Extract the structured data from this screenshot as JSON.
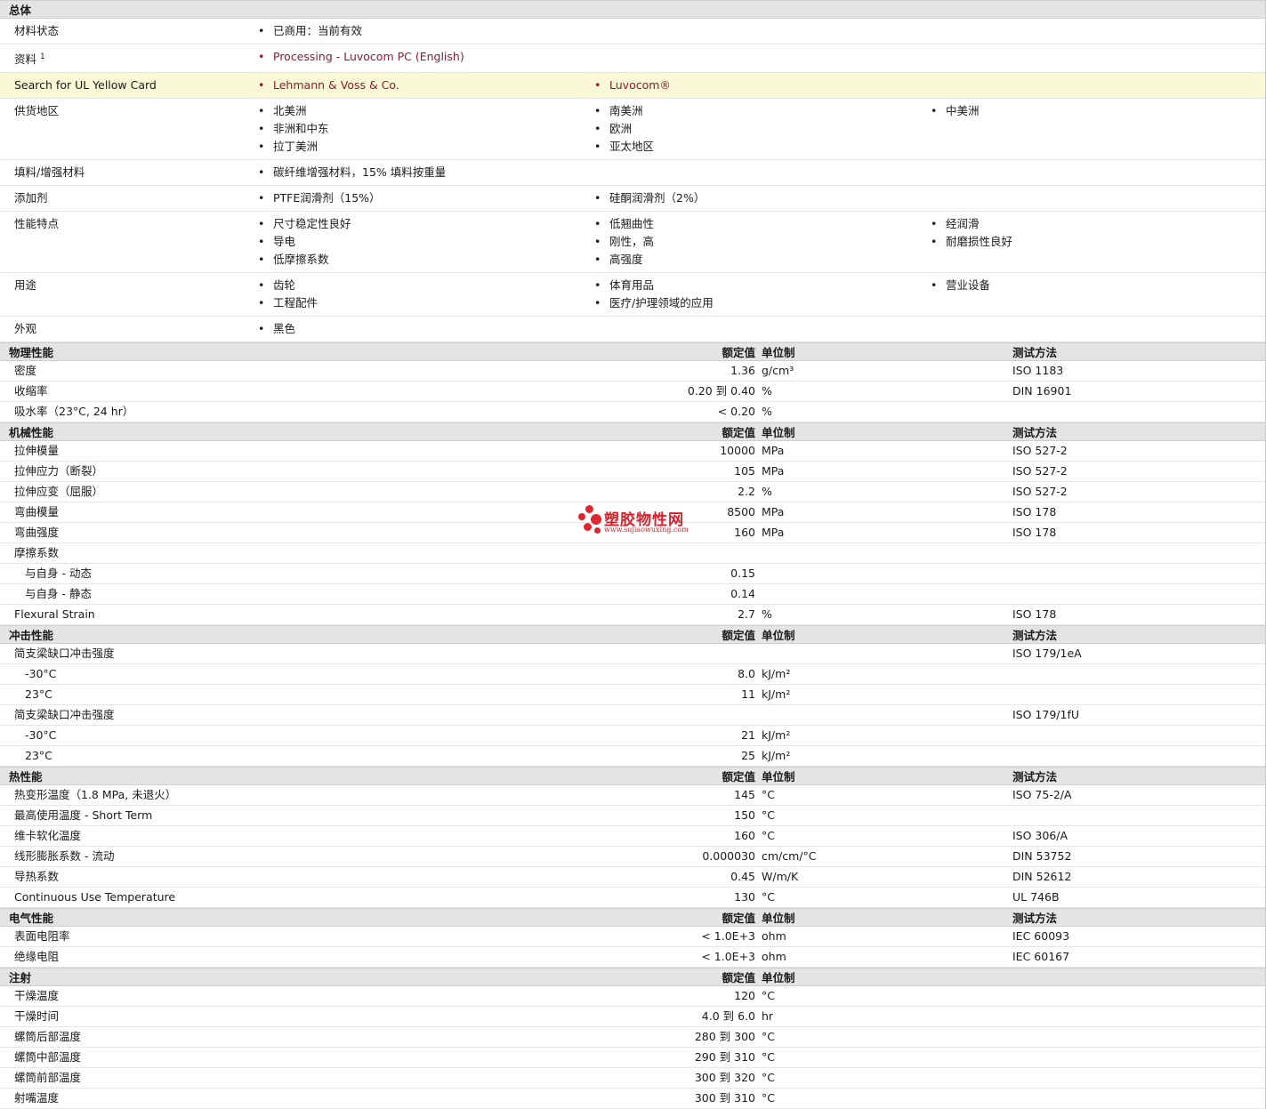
{
  "general": {
    "title": "总体",
    "rows": [
      {
        "label": "材料状态",
        "cols": [
          [
            "已商用：当前有效"
          ]
        ]
      },
      {
        "label": "资料",
        "sup": "1",
        "link": true,
        "cols": [
          [
            "Processing - Luvocom PC (English)"
          ]
        ]
      },
      {
        "label": "Search for UL Yellow Card",
        "highlight": true,
        "link": true,
        "cols": [
          [
            "Lehmann & Voss & Co."
          ],
          [
            "Luvocom®"
          ]
        ]
      },
      {
        "label": "供货地区",
        "cols": [
          [
            "北美洲",
            "非洲和中东",
            "拉丁美洲"
          ],
          [
            "南美洲",
            "欧洲",
            "亚太地区"
          ],
          [
            "中美洲"
          ]
        ]
      },
      {
        "label": "填料/增强材料",
        "cols": [
          [
            "碳纤维增强材料，15% 填料按重量"
          ]
        ]
      },
      {
        "label": "添加剂",
        "cols": [
          [
            "PTFE润滑剂（15%）"
          ],
          [
            "硅酮润滑剂（2%）"
          ]
        ]
      },
      {
        "label": "性能特点",
        "cols": [
          [
            "尺寸稳定性良好",
            "导电",
            "低摩擦系数"
          ],
          [
            "低翘曲性",
            "刚性，高",
            "高强度"
          ],
          [
            "经润滑",
            "耐磨损性良好"
          ]
        ]
      },
      {
        "label": "用途",
        "cols": [
          [
            "齿轮",
            "工程配件"
          ],
          [
            "体育用品",
            "医疗/护理领域的应用"
          ],
          [
            "营业设备"
          ]
        ]
      },
      {
        "label": "外观",
        "cols": [
          [
            "黑色"
          ]
        ]
      }
    ]
  },
  "headers": {
    "nominal": "额定值",
    "unit": "单位制",
    "test": "测试方法"
  },
  "sections": [
    {
      "title": "物理性能",
      "show_test": true,
      "rows": [
        {
          "label": "密度",
          "value": "1.36",
          "unit": "g/cm³",
          "test": "ISO 1183"
        },
        {
          "label": "收缩率",
          "value": "0.20 到  0.40",
          "unit": "%",
          "test": "DIN 16901"
        },
        {
          "label": "吸水率（23°C, 24 hr）",
          "value": "< 0.20",
          "unit": "%",
          "test": ""
        }
      ]
    },
    {
      "title": "机械性能",
      "show_test": true,
      "rows": [
        {
          "label": "拉伸模量",
          "value": "10000",
          "unit": "MPa",
          "test": "ISO 527-2"
        },
        {
          "label": "拉伸应力（断裂）",
          "value": "105",
          "unit": "MPa",
          "test": "ISO 527-2"
        },
        {
          "label": "拉伸应变（屈服）",
          "value": "2.2",
          "unit": "%",
          "test": "ISO 527-2"
        },
        {
          "label": "弯曲模量",
          "value": "8500",
          "unit": "MPa",
          "test": "ISO 178"
        },
        {
          "label": "弯曲强度",
          "value": "160",
          "unit": "MPa",
          "test": "ISO 178"
        },
        {
          "label": "摩擦系数",
          "value": "",
          "unit": "",
          "test": ""
        },
        {
          "label": "与自身  - 动态",
          "indent": true,
          "value": "0.15",
          "unit": "",
          "test": ""
        },
        {
          "label": "与自身  - 静态",
          "indent": true,
          "value": "0.14",
          "unit": "",
          "test": ""
        },
        {
          "label": "Flexural Strain",
          "value": "2.7",
          "unit": "%",
          "test": "ISO 178"
        }
      ]
    },
    {
      "title": "冲击性能",
      "show_test": true,
      "rows": [
        {
          "label": "简支梁缺口冲击强度",
          "value": "",
          "unit": "",
          "test": "ISO 179/1eA"
        },
        {
          "label": "-30°C",
          "indent": true,
          "value": "8.0",
          "unit": "kJ/m²",
          "test": ""
        },
        {
          "label": "23°C",
          "indent": true,
          "value": "11",
          "unit": "kJ/m²",
          "test": ""
        },
        {
          "label": "简支梁缺口冲击强度",
          "value": "",
          "unit": "",
          "test": "ISO 179/1fU"
        },
        {
          "label": "-30°C",
          "indent": true,
          "value": "21",
          "unit": "kJ/m²",
          "test": ""
        },
        {
          "label": "23°C",
          "indent": true,
          "value": "25",
          "unit": "kJ/m²",
          "test": ""
        }
      ]
    },
    {
      "title": "热性能",
      "show_test": true,
      "rows": [
        {
          "label": "热变形温度（1.8 MPa, 未退火）",
          "value": "145",
          "unit": "°C",
          "test": "ISO 75-2/A"
        },
        {
          "label": "最高使用温度  - Short Term",
          "value": "150",
          "unit": "°C",
          "test": ""
        },
        {
          "label": "维卡软化温度",
          "value": "160",
          "unit": "°C",
          "test": "ISO 306/A"
        },
        {
          "label": "线形膨胀系数  - 流动",
          "value": "0.000030",
          "unit": "cm/cm/°C",
          "test": "DIN 53752"
        },
        {
          "label": "导热系数",
          "value": "0.45",
          "unit": "W/m/K",
          "test": "DIN 52612"
        },
        {
          "label": "Continuous Use Temperature",
          "value": "130",
          "unit": "°C",
          "test": "UL 746B"
        }
      ]
    },
    {
      "title": "电气性能",
      "show_test": true,
      "rows": [
        {
          "label": "表面电阻率",
          "value": "< 1.0E+3",
          "unit": "ohm",
          "test": "IEC 60093"
        },
        {
          "label": "绝缘电阻",
          "value": "< 1.0E+3",
          "unit": "ohm",
          "test": "IEC 60167"
        }
      ]
    },
    {
      "title": "注射",
      "show_test": false,
      "rows": [
        {
          "label": "干燥温度",
          "value": "120",
          "unit": "°C",
          "test": ""
        },
        {
          "label": "干燥时间",
          "value": "4.0 到  6.0",
          "unit": "hr",
          "test": ""
        },
        {
          "label": "螺筒后部温度",
          "value": "280 到  300",
          "unit": "°C",
          "test": ""
        },
        {
          "label": "螺筒中部温度",
          "value": "290 到  310",
          "unit": "°C",
          "test": ""
        },
        {
          "label": "螺筒前部温度",
          "value": "300 到  320",
          "unit": "°C",
          "test": ""
        },
        {
          "label": "射嘴温度",
          "value": "300 到  310",
          "unit": "°C",
          "test": ""
        }
      ]
    }
  ],
  "watermark": {
    "text": "塑胶物性网",
    "url": "www.sujiaowuxing.com"
  }
}
